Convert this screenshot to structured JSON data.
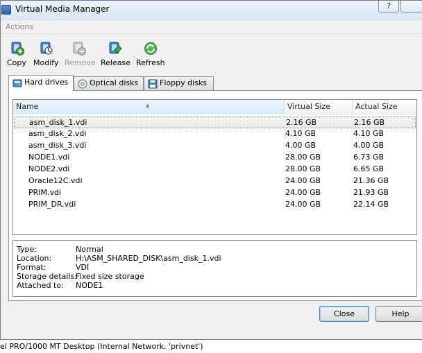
{
  "window": {
    "title": "Virtual Media Manager",
    "help_label": "?"
  },
  "menu": {
    "actions_label": "Actions"
  },
  "toolbar": {
    "items": [
      {
        "label": "Copy",
        "enabled": true
      },
      {
        "label": "Modify",
        "enabled": true
      },
      {
        "label": "Remove",
        "enabled": false
      },
      {
        "label": "Release",
        "enabled": true
      },
      {
        "label": "Refresh",
        "enabled": true
      }
    ]
  },
  "tabs": [
    {
      "label": "Hard drives",
      "active": true
    },
    {
      "label": "Optical disks",
      "active": false
    },
    {
      "label": "Floppy disks",
      "active": false
    }
  ],
  "table": {
    "columns": [
      "Name",
      "Virtual Size",
      "Actual Size"
    ],
    "rows": [
      {
        "name": "asm_disk_1.vdi",
        "virtual": "2.16 GB",
        "actual": "2.16 GB",
        "selected": true
      },
      {
        "name": "asm_disk_2.vdi",
        "virtual": "4.10 GB",
        "actual": "4.10 GB"
      },
      {
        "name": "asm_disk_3.vdi",
        "virtual": "4.00 GB",
        "actual": "4.00 GB"
      },
      {
        "name": "NODE1.vdi",
        "virtual": "28.00 GB",
        "actual": "6.73 GB"
      },
      {
        "name": "NODE2.vdi",
        "virtual": "28.00 GB",
        "actual": "6.65 GB"
      },
      {
        "name": "Oracle12C.vdi",
        "virtual": "24.00 GB",
        "actual": "21.36 GB"
      },
      {
        "name": "PRIM.vdi",
        "virtual": "24.00 GB",
        "actual": "21.93 GB"
      },
      {
        "name": "PRIM_DR.vdi",
        "virtual": "24.00 GB",
        "actual": "22.14 GB"
      }
    ]
  },
  "details": [
    {
      "label": "Type:",
      "value": "Normal"
    },
    {
      "label": "Location:",
      "value": "H:\\ASM_SHARED_DISK\\asm_disk_1.vdi"
    },
    {
      "label": "Format:",
      "value": "VDI"
    },
    {
      "label": "Storage details:",
      "value": "Fixed size storage"
    },
    {
      "label": "Attached to:",
      "value": "NODE1"
    }
  ],
  "buttons": {
    "close": "Close",
    "help": "Help"
  },
  "status_text": "el PRO/1000 MT Desktop (Internal Network, 'privnet')",
  "colors": {
    "accent": "#3c7fb1",
    "selected_row": "#e9e9e9",
    "disabled_text": "#9a9a9a"
  }
}
